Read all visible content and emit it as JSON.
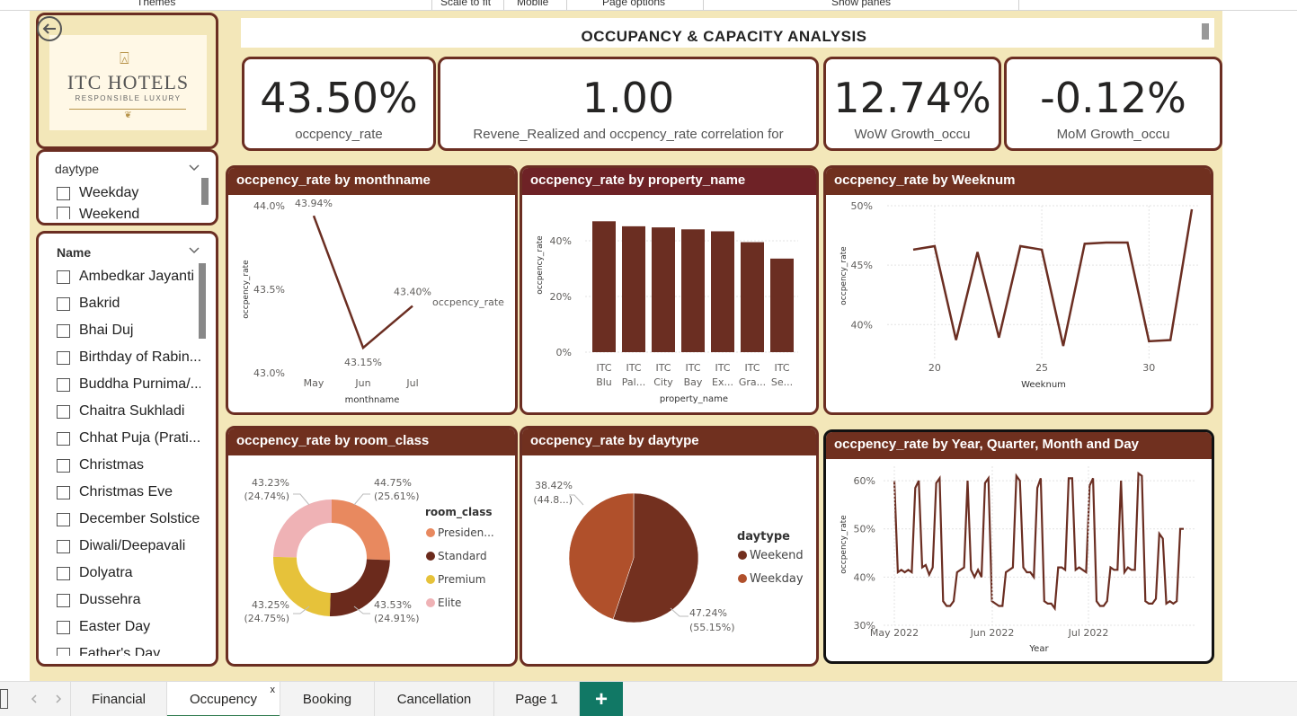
{
  "toolbar": {
    "items": [
      "Themes",
      "Scale to fit",
      "Mobile",
      "Page options",
      "Show panes"
    ]
  },
  "logo": {
    "brand": "ITC HOTELS",
    "tagline": "RESPONSIBLE LUXURY"
  },
  "page_title": "OCCUPANCY & CAPACITY ANALYSIS",
  "kpis": [
    {
      "value": "43.50%",
      "label": "occpency_rate"
    },
    {
      "value": "1.00",
      "label": "Revene_Realized and occpency_rate correlation for"
    },
    {
      "value": "12.74%",
      "label": "WoW Growth_occu"
    },
    {
      "value": "-0.12%",
      "label": "MoM Growth_occu"
    }
  ],
  "slicer_daytype": {
    "title": "daytype",
    "items": [
      "Weekday",
      "Weekend"
    ]
  },
  "slicer_name": {
    "title": "Name",
    "items": [
      "Ambedkar Jayanti",
      "Bakrid",
      "Bhai Duj",
      "Birthday of Rabin...",
      "Buddha Purnima/...",
      "Chaitra Sukhladi",
      "Chhat Puja (Prati...",
      "Christmas",
      "Christmas Eve",
      "December Solstice",
      "Diwali/Deepavali",
      "Dolyatra",
      "Dussehra",
      "Easter Day",
      "Father's Day"
    ]
  },
  "visuals": {
    "month": "occpency_rate by monthname",
    "property": "occpency_rate by property_name",
    "week": "occpency_rate by Weeknum",
    "room": "occpency_rate by room_class",
    "daytype": "occpency_rate by daytype",
    "date": "occpency_rate by Year, Quarter, Month and Day"
  },
  "chart_data": [
    {
      "type": "line",
      "title": "occpency_rate by monthname",
      "xlabel": "monthname",
      "ylabel": "occpency_rate",
      "categories": [
        "May",
        "Jun",
        "Jul"
      ],
      "series": [
        {
          "name": "occpency_rate",
          "values": [
            43.94,
            43.15,
            43.4
          ]
        }
      ],
      "data_labels": [
        "43.94%",
        "43.15%",
        "43.40%"
      ],
      "ylim": [
        43.0,
        44.0
      ],
      "yticks": [
        "44.0%",
        "43.5%",
        "43.0%"
      ],
      "legend": "right"
    },
    {
      "type": "bar",
      "title": "occpency_rate by property_name",
      "xlabel": "property_name",
      "ylabel": "occpency_rate",
      "categories": [
        [
          "ITC",
          "Blu"
        ],
        [
          "ITC",
          "Pal..."
        ],
        [
          "ITC",
          "City"
        ],
        [
          "ITC",
          "Bay"
        ],
        [
          "ITC",
          "Ex..."
        ],
        [
          "ITC",
          "Gra..."
        ],
        [
          "ITC",
          "Se..."
        ]
      ],
      "values": [
        47,
        45.2,
        44.8,
        44.1,
        43.4,
        39.5,
        33.6
      ],
      "ylim": [
        0,
        50
      ],
      "yticks": [
        "40%",
        "20%",
        "0%"
      ]
    },
    {
      "type": "line",
      "title": "occpency_rate by Weeknum",
      "xlabel": "Weeknum",
      "ylabel": "occpency_rate",
      "x": [
        19,
        20,
        21,
        22,
        23,
        24,
        25,
        26,
        27,
        28,
        29,
        30,
        31,
        32
      ],
      "values": [
        46.3,
        46.6,
        38.7,
        46.1,
        38.9,
        46.6,
        46.3,
        38.2,
        46.8,
        46.9,
        46.9,
        38.6,
        38.7,
        49.7
      ],
      "ylim": [
        37,
        50
      ],
      "yticks": [
        "50%",
        "45%",
        "40%"
      ],
      "xticks": [
        "20",
        "25",
        "30"
      ]
    },
    {
      "type": "pie",
      "title": "occpency_rate by room_class",
      "legend_title": "room_class",
      "legend": [
        "Presiden...",
        "Standard",
        "Premium",
        "Elite"
      ],
      "values": [
        44.75,
        43.53,
        43.25,
        43.23
      ],
      "labels": [
        [
          "44.75%",
          "(25.61%)"
        ],
        [
          "43.53%",
          "(24.91%)"
        ],
        [
          "43.25%",
          "(24.75%)"
        ],
        [
          "43.23%",
          "(24.74%)"
        ]
      ],
      "colors": [
        "#e8895f",
        "#6b2a1c",
        "#e6c23a",
        "#efb2b5"
      ]
    },
    {
      "type": "pie",
      "title": "occpency_rate by daytype",
      "legend_title": "daytype",
      "legend": [
        "Weekend",
        "Weekday"
      ],
      "values": [
        47.24,
        38.42
      ],
      "labels": [
        [
          "47.24%",
          "(55.15%)"
        ],
        [
          "38.42%",
          "(44.8...)"
        ]
      ],
      "colors": [
        "#73301f",
        "#b0502b"
      ]
    },
    {
      "type": "line",
      "title": "occpency_rate by Year, Quarter, Month and Day",
      "xlabel": "Year",
      "ylabel": "occpency_rate",
      "xticks": [
        "May 2022",
        "Jun 2022",
        "Jul 2022"
      ],
      "yticks": [
        "60%",
        "50%",
        "40%",
        "30%"
      ],
      "ylim": [
        30,
        63
      ],
      "values": [
        60,
        41,
        41.5,
        41,
        41.5,
        41,
        58.5,
        60,
        42,
        42.5,
        40.5,
        42,
        59.5,
        60.5,
        35,
        34,
        34,
        35,
        41,
        41.5,
        42,
        60,
        41.5,
        40,
        41.5,
        40,
        59.5,
        60.5,
        35,
        34.5,
        34,
        34,
        41,
        41.5,
        42,
        61,
        60,
        42,
        41,
        41,
        40,
        58.5,
        60.5,
        35,
        34.5,
        34.5,
        33.5,
        42,
        42,
        41.5,
        60.5,
        60.5,
        41.5,
        42,
        41.5,
        41,
        59,
        60.5,
        35,
        34,
        34,
        35,
        42,
        41.5,
        41.5,
        60,
        41,
        42,
        41.5,
        41.5,
        61.5,
        61,
        35,
        34.5,
        34.5,
        35.5,
        49,
        48,
        34.5,
        35,
        34.5,
        35,
        50,
        50
      ]
    }
  ],
  "pages": {
    "tabs": [
      "Financial",
      "Occupency",
      "Booking",
      "Cancellation",
      "Page 1"
    ],
    "active": "Occupency",
    "close": "x",
    "add": "+"
  }
}
